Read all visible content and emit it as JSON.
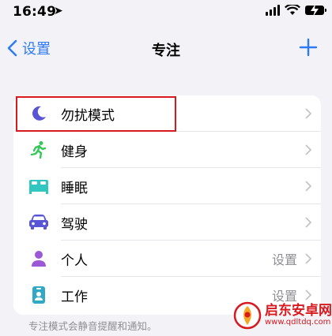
{
  "status": {
    "time": "16:49",
    "battery_color": "#000000"
  },
  "nav": {
    "back_label": "设置",
    "title": "专注",
    "accent": "#2f7bf6"
  },
  "items": [
    {
      "label": "勿扰模式",
      "value": "",
      "icon": "moon-icon",
      "color": "#5856d6"
    },
    {
      "label": "健身",
      "value": "",
      "icon": "running-icon",
      "color": "#34c759"
    },
    {
      "label": "睡眠",
      "value": "",
      "icon": "bed-icon",
      "color": "#31c6c0"
    },
    {
      "label": "驾驶",
      "value": "",
      "icon": "car-icon",
      "color": "#5856d6"
    },
    {
      "label": "个人",
      "value": "设置",
      "icon": "person-icon",
      "color": "#9b59d6"
    },
    {
      "label": "工作",
      "value": "设置",
      "icon": "badge-icon",
      "color": "#31a8c6"
    }
  ],
  "footer": {
    "note": "专注模式会静音提醒和通知。"
  },
  "watermark": {
    "name": "启东安卓网",
    "url": "www.qdltdq.com"
  },
  "highlight_color": "#d71920"
}
